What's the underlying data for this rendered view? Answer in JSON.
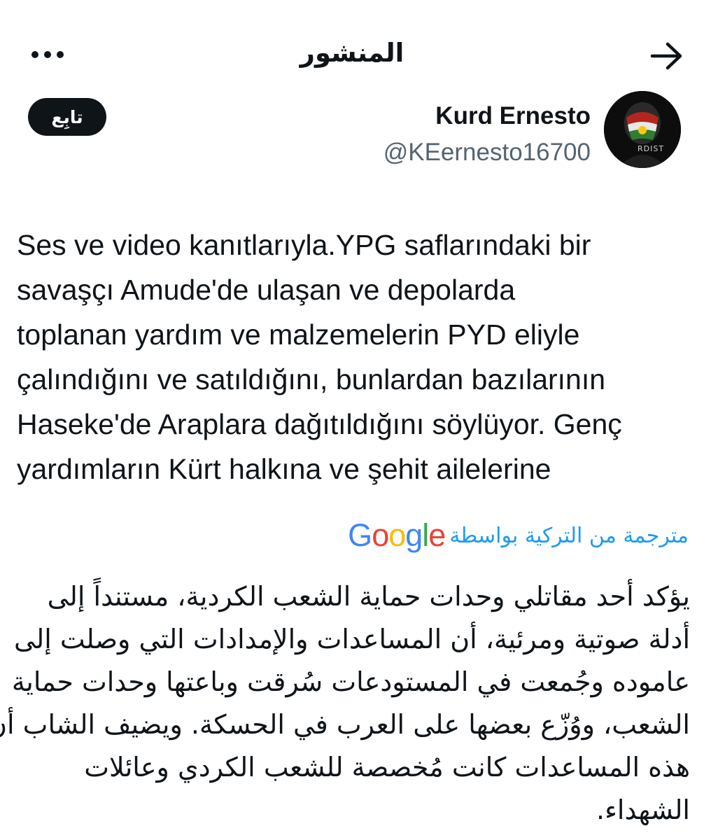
{
  "header": {
    "title": "المنشور",
    "back_icon": "arrow-right-icon",
    "more_icon": "ellipsis-icon"
  },
  "author": {
    "display_name": "Kurd Ernesto",
    "handle": "@KEernesto16700",
    "follow_label": "تابِع",
    "avatar_text": "RDIST"
  },
  "post": {
    "lines": [
      "Ses ve video kanıtlarıyla.YPG saflarındaki bir",
      "savaşçı Amude'de  ulaşan ve depolarda",
      "toplanan yardım ve malzemelerin PYD eliyle",
      "çalındığını ve satıldığını, bunlardan bazılarının",
      "Haseke'de Araplara dağıtıldığını söylüyor. Genç",
      "yardımların Kürt halkına ve şehit ailelerine"
    ]
  },
  "translation": {
    "label": "مترجمة من التركية بواسطة",
    "provider_letters": [
      "G",
      "o",
      "o",
      "g",
      "l",
      "e"
    ],
    "provider_colors": [
      "#4285F4",
      "#EA4335",
      "#FBBC05",
      "#4285F4",
      "#34A853",
      "#EA4335"
    ],
    "lines": [
      "يؤكد أحد مقاتلي وحدات حماية الشعب الكردية، مستنداً إلى",
      "أدلة صوتية ومرئية، أن المساعدات والإمدادات التي وصلت إلى",
      "عاموده وجُمعت في المستودعات سُرقت وباعتها وحدات حماية",
      "الشعب، ووُزّع بعضها على العرب في الحسكة. ويضيف الشاب أن",
      "هذه المساعدات كانت مُخصصة للشعب الكردي وعائلات",
      "الشهداء."
    ]
  },
  "colors": {
    "text": "#0f1419",
    "secondary": "#536471",
    "link": "#1d9bf0",
    "button_bg": "#0f1419"
  }
}
